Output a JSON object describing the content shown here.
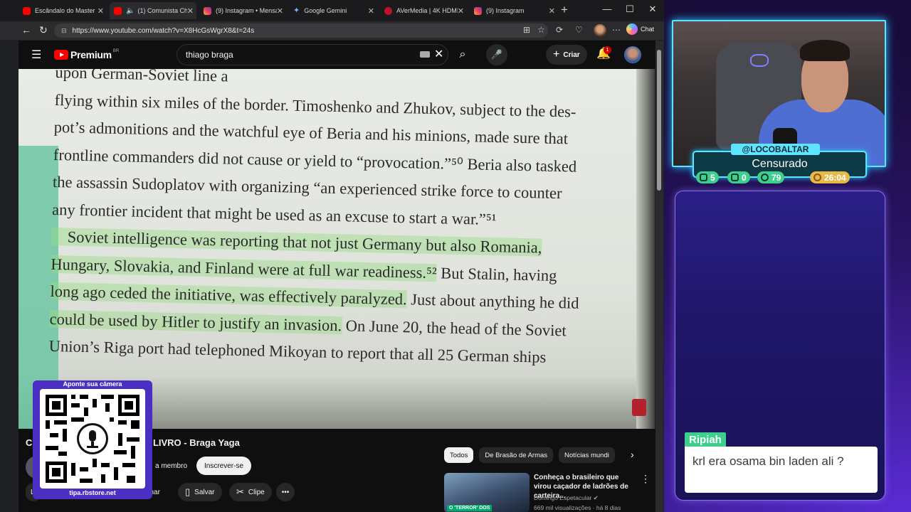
{
  "browser": {
    "tabs": [
      {
        "label": "Escândalo do Master s",
        "favicon": "youtube-icon",
        "active": false
      },
      {
        "label": "(1) Comunista Chi",
        "favicon": "youtube-icon",
        "active": true,
        "audio": true
      },
      {
        "label": "(9) Instagram • Mensa",
        "favicon": "instagram-icon",
        "active": false
      },
      {
        "label": "Google Gemini",
        "favicon": "gemini-icon",
        "active": false
      },
      {
        "label": "AVerMedia | 4K HDMI",
        "favicon": "avermedia-icon",
        "active": false
      },
      {
        "label": "(9) Instagram",
        "favicon": "instagram-icon",
        "active": false
      }
    ],
    "url": "https://www.youtube.com/watch?v=X8HcGsWgrX8&t=24s",
    "copilot_label": "Chat"
  },
  "youtube": {
    "brand": "Premium",
    "country_code": "BR",
    "search_query": "thiago braga",
    "create_label": "Criar",
    "notification_count": "1"
  },
  "video": {
    "book_lines": [
      {
        "pre": "upon German-Soviet line a",
        "hl": "",
        "post": ""
      },
      {
        "pre": "flying within six miles of the border. Timoshenko and Zhukov, subject to the des-",
        "hl": "",
        "post": ""
      },
      {
        "pre": "pot’s admonitions and the watchful eye of Beria and his minions, made sure that",
        "hl": "",
        "post": ""
      },
      {
        "pre": "frontline commanders did not cause or yield to “provocation.”⁵⁰ Beria also tasked",
        "hl": "",
        "post": ""
      },
      {
        "pre": "the assassin Sudoplatov with organizing “an experienced strike force to counter",
        "hl": "",
        "post": ""
      },
      {
        "pre": "any frontier incident that might be used as an excuse to start a war.”⁵¹",
        "hl": "",
        "post": ""
      },
      {
        "pre": "",
        "hl": "    Soviet intelligence was reporting that not just Germany but also Romania,",
        "post": ""
      },
      {
        "pre": "",
        "hl": "Hungary, Slovakia, and Finland were at full war readiness.⁵²",
        "post": " But Stalin, having"
      },
      {
        "pre": "",
        "hl": "long ago ceded the initiative, was effectively paralyzed.",
        "post": " Just about anything he did"
      },
      {
        "pre": "",
        "hl": "could be used by Hitler to justify an invasion.",
        "post": " On June 20, the head of the Soviet"
      },
      {
        "pre": "Union’s Riga port had telephoned Mikoyan to report that all 25 German ships",
        "hl": "",
        "post": ""
      }
    ],
    "title_visible": "C",
    "title_rest": "u LIVRO - Braga Yaga",
    "member_label": "a membro",
    "subscribe_label": "Inscrever-se",
    "share_label": "ilhar",
    "save_label": "Salvar",
    "clip_label": "Clipe",
    "left_fragment": "L"
  },
  "recommendations": {
    "chips": [
      "Todos",
      "De Brasão de Armas",
      "Notícias mundi"
    ],
    "item": {
      "title": "Conheça o brasileiro que virou caçador de ladrões de carteira...",
      "channel": "Domingo Espetacular",
      "meta": "669 mil visualizações · há 8 dias",
      "thumb_tag": "O 'TERROR' DOS"
    }
  },
  "qr_overlay": {
    "header": "Aponte sua câmera",
    "footer": "tipa.rbstore.net"
  },
  "stream": {
    "handle": "@LOCOBALTAR",
    "title": "Censurado",
    "stats": [
      {
        "icon": "twitch-icon",
        "value": "5"
      },
      {
        "icon": "youtube-icon",
        "value": "0"
      },
      {
        "icon": "kick-icon",
        "value": "79"
      },
      {
        "icon": "clock-icon",
        "value": "26:04"
      }
    ],
    "chat": {
      "username": "Ripiah",
      "message": "krl era osama bin laden ali ?"
    }
  },
  "colors": {
    "accent_cyan": "#5fe4ff",
    "chat_green": "#3ecf8e",
    "timer_gold": "#e8b84a",
    "youtube_red": "#ff0000"
  }
}
